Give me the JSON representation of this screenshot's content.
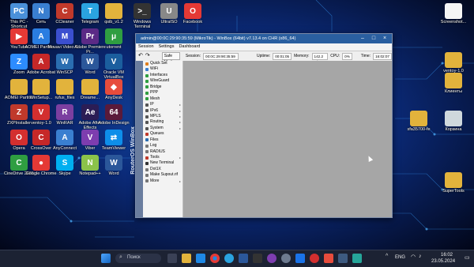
{
  "desktop": {
    "icons_left": [
      {
        "label": "This PC - Shortcut",
        "color": "#4a90d9",
        "glyph": "PC"
      },
      {
        "label": "Сеть",
        "color": "#3a7fd0",
        "glyph": "N"
      },
      {
        "label": "CCleaner",
        "color": "#c0392b",
        "glyph": "C"
      },
      {
        "label": "Telegram",
        "color": "#2aa3e0",
        "glyph": "T"
      },
      {
        "label": "qsib_v1.2",
        "color": "#e2b33c",
        "glyph": ""
      },
      {
        "label": "Windows Terminal",
        "color": "#333",
        "glyph": ">_"
      },
      {
        "label": "UltraISO",
        "color": "#888",
        "glyph": "U"
      },
      {
        "label": "Facebook",
        "color": "#e53935",
        "glyph": "O"
      },
      {
        "label": "YouTube",
        "color": "#e53935",
        "glyph": "▶"
      },
      {
        "label": "AOMEI Partitio...",
        "color": "#2a7de1",
        "glyph": "A"
      },
      {
        "label": "Movavi Video C...",
        "color": "#3b4fcf",
        "glyph": "M"
      },
      {
        "label": "Adobe Premiere Pr...",
        "color": "#5b2a86",
        "glyph": "Pr"
      },
      {
        "label": "utorrent",
        "color": "#2f9e41",
        "glyph": "μ"
      },
      {
        "label": "Zoom",
        "color": "#2d8cff",
        "glyph": "Z"
      },
      {
        "label": "Adobe Acrobat",
        "color": "#c62828",
        "glyph": "A"
      },
      {
        "label": "WinSCP",
        "color": "#2a6db0",
        "glyph": "W"
      },
      {
        "label": "Word",
        "color": "#2b579a",
        "glyph": "W"
      },
      {
        "label": "Oracle VM VirtualBox",
        "color": "#1b5e9e",
        "glyph": "V"
      },
      {
        "label": "AOMEI Partitio",
        "color": "#e2b33c",
        "glyph": ""
      },
      {
        "label": "WinSetup...",
        "color": "#e2b33c",
        "glyph": ""
      },
      {
        "label": "rufus_files",
        "color": "#e2b33c",
        "glyph": ""
      },
      {
        "label": "Dreame...",
        "color": "#e2b33c",
        "glyph": ""
      },
      {
        "label": "AnyDesk",
        "color": "#e74c3c",
        "glyph": "◆"
      },
      {
        "label": "ZXPInstaller",
        "color": "#c0392b",
        "glyph": "Z"
      },
      {
        "label": "ventoy-1.0",
        "color": "#d32f2f",
        "glyph": "V"
      },
      {
        "label": "WinRAR",
        "color": "#7b3fa0",
        "glyph": "R"
      },
      {
        "label": "Adobe After Effects",
        "color": "#2b1d55",
        "glyph": "Ae"
      },
      {
        "label": "Adobe InDesign",
        "color": "#5a1a3a",
        "glyph": "64"
      },
      {
        "label": "Opera",
        "color": "#d32f2f",
        "glyph": "O"
      },
      {
        "label": "CrossOver",
        "color": "#c62828",
        "glyph": "C"
      },
      {
        "label": "AnyConnect",
        "color": "#3a7fd0",
        "glyph": "A"
      },
      {
        "label": "Viber",
        "color": "#7d3daf",
        "glyph": "V"
      },
      {
        "label": "TeamViewer",
        "color": "#0e8ee9",
        "glyph": "⇄"
      },
      {
        "label": "CineDrive 2021",
        "color": "#2f9e41",
        "glyph": "C"
      },
      {
        "label": "Google Chrome",
        "color": "#e53935",
        "glyph": "●"
      },
      {
        "label": "Skype",
        "color": "#00aff0",
        "glyph": "S"
      },
      {
        "label": "Notepad++",
        "color": "#8bc34a",
        "glyph": "N"
      },
      {
        "label": "Word",
        "color": "#2b579a",
        "glyph": "W"
      }
    ],
    "icons_right": [
      {
        "label": "Screenshot...",
        "color": "#f5f5f5",
        "glyph": ""
      },
      {
        "label": "ventoy-1.0",
        "color": "#e2b33c",
        "glyph": ""
      },
      {
        "label": "Клиенты",
        "color": "#e2b33c",
        "glyph": ""
      },
      {
        "label": "sfa35700-fe",
        "color": "#e2b33c",
        "glyph": ""
      },
      {
        "label": "Корзина",
        "color": "#cfd8dc",
        "glyph": ""
      },
      {
        "label": "SuperTools",
        "color": "#e2b33c",
        "glyph": ""
      }
    ]
  },
  "winbox": {
    "title": "admin@00:0C:29:90:35:59 (MikroTik) - WinBox (64bit) v7.13.4 on CHR (x86_64)",
    "menu": [
      "Session",
      "Settings",
      "Dashboard"
    ],
    "toolbar": {
      "undo_icon": "undo-icon",
      "redo_icon": "redo-icon",
      "safe_mode": "Safe Mode",
      "session_label": "Session:",
      "session_value": "00:0C:29:90:35:59",
      "uptime_label": "Uptime:",
      "uptime_value": "00:01:05",
      "memory_label": "Memory:",
      "memory_value": "142.2 MiB",
      "cpu_label": "CPU:",
      "cpu_value": "0%",
      "time_label": "Time:",
      "time_value": "16:02:07"
    },
    "side_caption": "RouterOS WinBox",
    "sidebar": [
      {
        "label": "Quick Set",
        "color": "#e08020",
        "sub": false
      },
      {
        "label": "WiFi",
        "color": "#3a7fd0",
        "sub": false
      },
      {
        "label": "Interfaces",
        "color": "#2f9e41",
        "sub": false
      },
      {
        "label": "WireGuard",
        "color": "#2f9e41",
        "sub": false
      },
      {
        "label": "Bridge",
        "color": "#2f9e41",
        "sub": false
      },
      {
        "label": "PPP",
        "color": "#2f9e41",
        "sub": false
      },
      {
        "label": "Mesh",
        "color": "#2f9e41",
        "sub": false
      },
      {
        "label": "IP",
        "color": "#555",
        "sub": true
      },
      {
        "label": "IPv6",
        "color": "#555",
        "sub": true
      },
      {
        "label": "MPLS",
        "color": "#555",
        "sub": true
      },
      {
        "label": "Routing",
        "color": "#555",
        "sub": true
      },
      {
        "label": "System",
        "color": "#555",
        "sub": true
      },
      {
        "label": "Queues",
        "color": "#c0392b",
        "sub": false
      },
      {
        "label": "Files",
        "color": "#2a6db0",
        "sub": false
      },
      {
        "label": "Log",
        "color": "#777",
        "sub": false
      },
      {
        "label": "RADIUS",
        "color": "#777",
        "sub": false
      },
      {
        "label": "Tools",
        "color": "#c0392b",
        "sub": true
      },
      {
        "label": "New Terminal",
        "color": "#333",
        "sub": false
      },
      {
        "label": "Dot1X",
        "color": "#777",
        "sub": false
      },
      {
        "label": "Make Supout.rif",
        "color": "#777",
        "sub": false
      },
      {
        "label": "More",
        "color": "#777",
        "sub": true
      }
    ]
  },
  "taskbar": {
    "search_placeholder": "Поиск",
    "lang": "ENG",
    "time": "16:02",
    "date": "23.05.2024"
  }
}
